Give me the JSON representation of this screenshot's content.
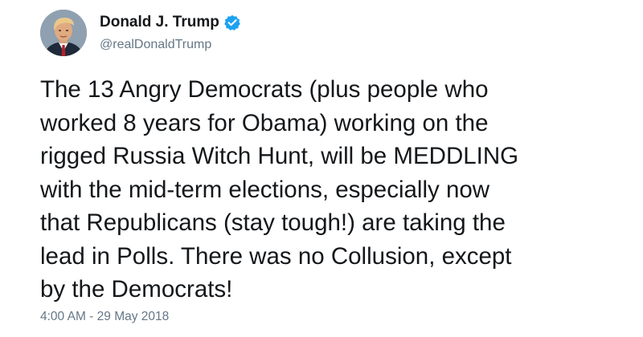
{
  "author": {
    "display_name": "Donald J. Trump",
    "handle": "@realDonaldTrump",
    "verified": true,
    "avatar_icon": "profile-photo"
  },
  "tweet": {
    "text_lines": [
      "The 13 Angry Democrats (plus people who",
      "worked 8 years for Obama) working on the",
      "rigged Russia Witch Hunt, will be MEDDLING",
      "with the mid-term elections, especially now",
      "that Republicans (stay tough!) are taking the",
      "lead in Polls. There was no Collusion, except",
      "by the Democrats!"
    ],
    "timestamp": "4:00 AM - 29 May 2018"
  },
  "colors": {
    "text": "#14171a",
    "secondary": "#657786",
    "verified_badge": "#1da1f2",
    "background": "#ffffff"
  }
}
